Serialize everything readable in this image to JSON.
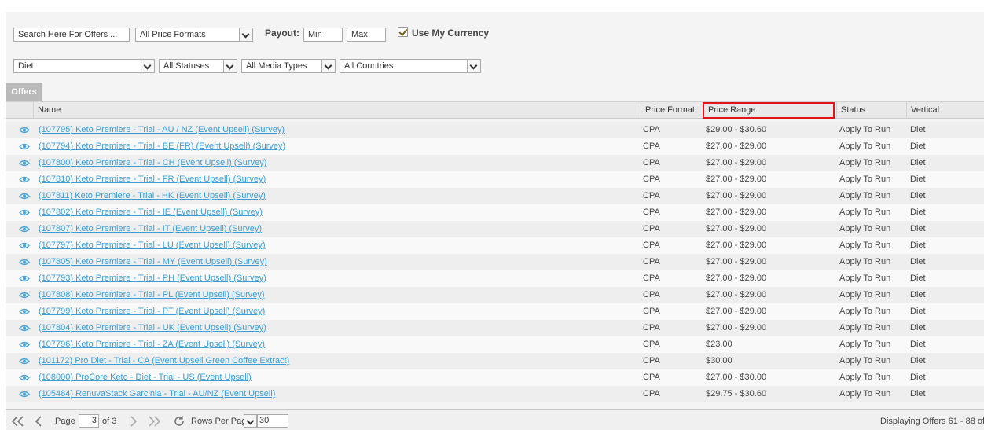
{
  "filters": {
    "search_placeholder": "Search Here For Offers ...",
    "price_format": "All Price Formats",
    "payout_label": "Payout:",
    "payout_min_placeholder": "Min",
    "payout_max_placeholder": "Max",
    "use_my_currency_label": "Use My Currency",
    "use_my_currency_checked": true,
    "vertical": "Diet",
    "status": "All Statuses",
    "media_type": "All Media Types",
    "country": "All Countries"
  },
  "tab": {
    "label": "Offers"
  },
  "columns": {
    "name": "Name",
    "price_format": "Price Format",
    "price_range": "Price Range",
    "status": "Status",
    "vertical": "Vertical"
  },
  "rows": [
    {
      "name": "(107795) Keto Premiere - Trial - AU / NZ (Event Upsell) (Survey)",
      "format": "CPA",
      "price": "$29.00 - $30.60",
      "status": "Apply To Run",
      "vertical": "Diet"
    },
    {
      "name": "(107794) Keto Premiere - Trial - BE (FR) (Event Upsell) (Survey)",
      "format": "CPA",
      "price": "$27.00 - $29.00",
      "status": "Apply To Run",
      "vertical": "Diet"
    },
    {
      "name": "(107800) Keto Premiere - Trial - CH (Event Upsell) (Survey)",
      "format": "CPA",
      "price": "$27.00 - $29.00",
      "status": "Apply To Run",
      "vertical": "Diet"
    },
    {
      "name": "(107810) Keto Premiere - Trial - FR (Event Upsell) (Survey)",
      "format": "CPA",
      "price": "$27.00 - $29.00",
      "status": "Apply To Run",
      "vertical": "Diet"
    },
    {
      "name": "(107811) Keto Premiere - Trial - HK (Event Upsell) (Survey)",
      "format": "CPA",
      "price": "$27.00 - $29.00",
      "status": "Apply To Run",
      "vertical": "Diet"
    },
    {
      "name": "(107802) Keto Premiere - Trial - IE (Event Upsell) (Survey)",
      "format": "CPA",
      "price": "$27.00 - $29.00",
      "status": "Apply To Run",
      "vertical": "Diet"
    },
    {
      "name": "(107807) Keto Premiere - Trial - IT (Event Upsell) (Survey)",
      "format": "CPA",
      "price": "$27.00 - $29.00",
      "status": "Apply To Run",
      "vertical": "Diet"
    },
    {
      "name": "(107797) Keto Premiere - Trial - LU (Event Upsell) (Survey)",
      "format": "CPA",
      "price": "$27.00 - $29.00",
      "status": "Apply To Run",
      "vertical": "Diet"
    },
    {
      "name": "(107805) Keto Premiere - Trial - MY (Event Upsell) (Survey)",
      "format": "CPA",
      "price": "$27.00 - $29.00",
      "status": "Apply To Run",
      "vertical": "Diet"
    },
    {
      "name": "(107793) Keto Premiere - Trial - PH (Event Upsell) (Survey)",
      "format": "CPA",
      "price": "$27.00 - $29.00",
      "status": "Apply To Run",
      "vertical": "Diet"
    },
    {
      "name": "(107808) Keto Premiere - Trial - PL (Event Upsell) (Survey)",
      "format": "CPA",
      "price": "$27.00 - $29.00",
      "status": "Apply To Run",
      "vertical": "Diet"
    },
    {
      "name": "(107799) Keto Premiere - Trial - PT (Event Upsell) (Survey)",
      "format": "CPA",
      "price": "$27.00 - $29.00",
      "status": "Apply To Run",
      "vertical": "Diet"
    },
    {
      "name": "(107804) Keto Premiere - Trial - UK (Event Upsell) (Survey)",
      "format": "CPA",
      "price": "$27.00 - $29.00",
      "status": "Apply To Run",
      "vertical": "Diet"
    },
    {
      "name": "(107796) Keto Premiere - Trial - ZA (Event Upsell) (Survey)",
      "format": "CPA",
      "price": "$23.00",
      "status": "Apply To Run",
      "vertical": "Diet"
    },
    {
      "name": "(101172) Pro Diet - Trial - CA (Event Upsell Green Coffee Extract)",
      "format": "CPA",
      "price": "$30.00",
      "status": "Apply To Run",
      "vertical": "Diet"
    },
    {
      "name": "(108000) ProCore Keto - Diet - Trial - US (Event Upsell)",
      "format": "CPA",
      "price": "$27.00 - $30.00",
      "status": "Apply To Run",
      "vertical": "Diet"
    },
    {
      "name": "(105484) RenuvaStack Garcinia - Trial - AU/NZ (Event Upsell)",
      "format": "CPA",
      "price": "$29.75 - $30.60",
      "status": "Apply To Run",
      "vertical": "Diet"
    }
  ],
  "pager": {
    "page_label": "Page",
    "current_page": "3",
    "of_label": "of 3",
    "rows_per_page_label": "Rows Per Pag",
    "rows_per_page": "30",
    "displaying": "Displaying Offers 61 - 88 of"
  },
  "colors": {
    "link": "#3a9fd6",
    "highlight": "#e0141a",
    "eye_icon": "#4aa3d8"
  },
  "icons": [
    "view-eye-icon",
    "first-page-icon",
    "prev-page-icon",
    "next-page-icon",
    "last-page-icon",
    "refresh-icon",
    "chevron-down-icon",
    "checkmark-icon"
  ]
}
